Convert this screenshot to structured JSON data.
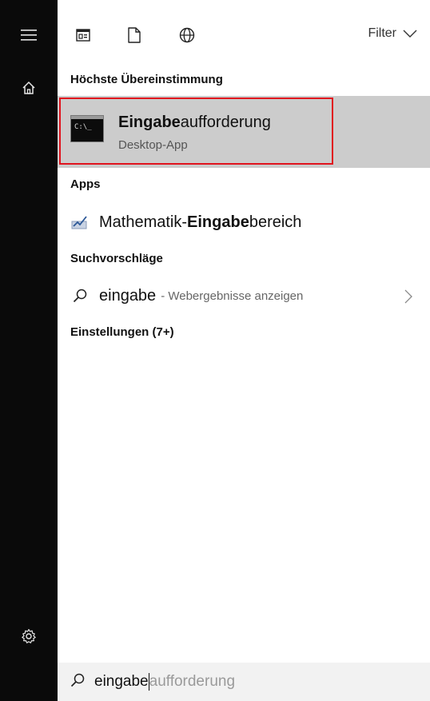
{
  "rail": {
    "menu_icon": "hamburger-menu-icon",
    "home_icon": "home-icon",
    "settings_icon": "settings-gear-icon"
  },
  "toolbar": {
    "filter_label": "Filter",
    "filter_icon": "chevron-down-icon",
    "tab_icons": [
      "apps-icon",
      "documents-icon",
      "web-globe-icon"
    ]
  },
  "best_match": {
    "header": "Höchste Übereinstimmung",
    "title_bold": "Eingabe",
    "title_rest": "aufforderung",
    "subtitle": "Desktop-App",
    "icon": "command-prompt-icon",
    "icon_text": "C:\\_",
    "highlight_color": "#e0141e"
  },
  "apps": {
    "header": "Apps",
    "items": [
      {
        "prefix": "Mathematik-",
        "bold": "Eingabe",
        "suffix": "bereich",
        "icon": "math-input-icon"
      }
    ]
  },
  "suggestions": {
    "header": "Suchvorschläge",
    "items": [
      {
        "query": "eingabe",
        "hint": "- Webergebnisse anzeigen",
        "icon": "search-icon",
        "arrow_icon": "chevron-right-icon"
      }
    ]
  },
  "settings": {
    "header": "Einstellungen (7+)"
  },
  "search": {
    "typed": "eingabe",
    "suggestion": "aufforderung",
    "icon": "search-icon"
  }
}
